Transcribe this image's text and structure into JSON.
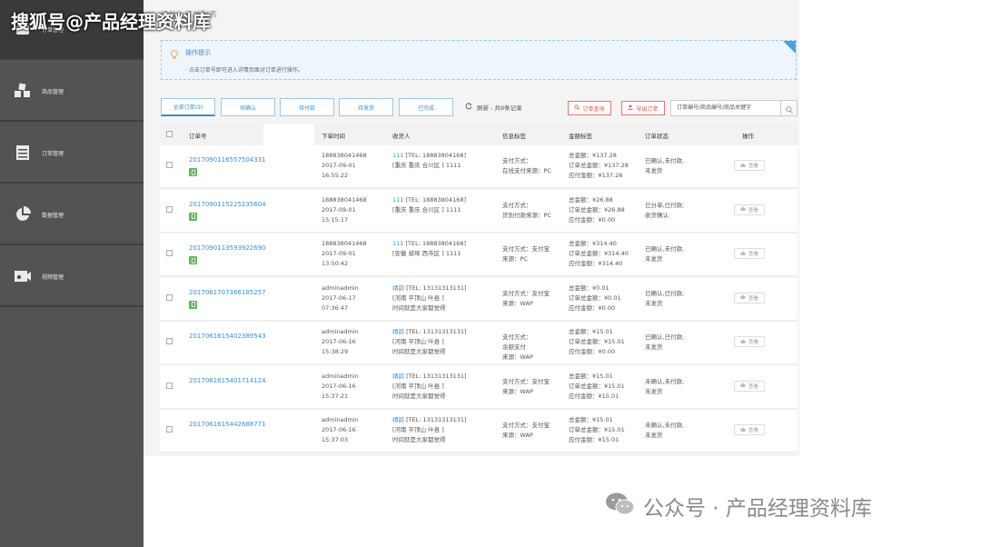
{
  "watermark": {
    "top": "搜狐号@产品经理资料库",
    "bottom": "公众号 · 产品经理资料库"
  },
  "breadcrumb": "订单 - 订单列表",
  "sidebar": {
    "items": [
      {
        "label": "订单管理",
        "icon": "home-icon"
      },
      {
        "label": "商品管理",
        "icon": "cubes-icon"
      },
      {
        "label": "订单管理",
        "icon": "list-icon"
      },
      {
        "label": "数据管理",
        "icon": "pie-chart-icon"
      },
      {
        "label": "视频管理",
        "icon": "video-icon"
      }
    ]
  },
  "tips": {
    "title": "操作提示",
    "line": "· 点击订单号即可进入详情页面对订单进行操作。"
  },
  "tabs": [
    "全部订单(9)",
    "待确认",
    "待付款",
    "待发货",
    "已完成"
  ],
  "refresh": "刷新 - 共9条记录",
  "buttons": {
    "search_orders": "订单查询",
    "export_orders": "导出订单"
  },
  "search": {
    "value": "订单编号/商品编号/商品关键字"
  },
  "columns": [
    "订单号",
    "下单时间",
    "收货人",
    "信息标签",
    "金额标签",
    "订单状态",
    "操作"
  ],
  "view_label": "查看",
  "rows": [
    {
      "order_no": "2017090116557504331",
      "badge": true,
      "time1": "188838041468",
      "time2": "2017-09-01",
      "time3": "16:55:22",
      "rec_name": "111",
      "rec1": " [TEL: 18883804168]",
      "rec2": "[重庆 重庆 合川区 ] 1111",
      "rec3": "",
      "info1": "支付方式：",
      "info2": "在线支付来源：PC",
      "info3": "",
      "amt1": "总金额：¥137.28",
      "amt2": "订单总金额：¥137.28",
      "amt3": "应付金额：¥137.28",
      "st1": "已确认,未付款,",
      "st2": "未发货"
    },
    {
      "order_no": "2017090115225235604",
      "badge": true,
      "time1": "188838041468",
      "time2": "2017-09-01",
      "time3": "15:15:17",
      "rec_name": "111",
      "rec1": " [TEL: 18883804168]",
      "rec2": "[重庆 重庆 合川区 ] 1111",
      "rec3": "",
      "info1": "支付方式：",
      "info2": "货到付款来源：PC",
      "info3": "",
      "amt1": "总金额：¥26.88",
      "amt2": "订单总金额：¥26.88",
      "amt3": "应付金额：¥0.00",
      "st1": "已分单,已付款,",
      "st2": "收货确认"
    },
    {
      "order_no": "2017090113593922690",
      "badge": true,
      "time1": "188838041468",
      "time2": "2017-09-01",
      "time3": "13:50:42",
      "rec_name": "111",
      "rec1": " [TEL: 18883804168]",
      "rec2": "[安徽 蚌埠 西市区 ] 1111",
      "rec3": "",
      "info1": "支付方式：支付宝",
      "info2": "来源：PC",
      "info3": "",
      "amt1": "总金额：¥314.40",
      "amt2": "订单总金额：¥314.40",
      "amt3": "应付金额：¥314.40",
      "st1": "已确认,未付款,",
      "st2": "未发货"
    },
    {
      "order_no": "2017061707366185257",
      "badge": true,
      "time1": "adminadmin",
      "time2": "2017-06-17",
      "time3": "07:36:47",
      "rec_name": "靖韵",
      "rec1": " [TEL: 13131313131]",
      "rec2": "[河南 平顶山 叶县 ]",
      "rec3": "时间就是大家都觉得",
      "info1": "支付方式：支付宝",
      "info2": "来源：WAP",
      "info3": "",
      "amt1": "总金额：¥0.01",
      "amt2": "订单总金额：¥0.01",
      "amt3": "应付金额：¥0.00",
      "st1": "已确认,已付款,",
      "st2": "未发货"
    },
    {
      "order_no": "2017061615402389543",
      "badge": false,
      "time1": "adminadmin",
      "time2": "2017-06-16",
      "time3": "15:38:29",
      "rec_name": "靖韵",
      "rec1": " [TEL: 13131313131]",
      "rec2": "[河南 平顶山 叶县 ]",
      "rec3": "时间就是大家都觉得",
      "info1": "支付方式：",
      "info2": "余额支付",
      "info3": "来源：WAP",
      "amt1": "总金额：¥15.01",
      "amt2": "订单总金额：¥15.01",
      "amt3": "应付金额：¥0.00",
      "st1": "已确认,已付款,",
      "st2": "未发货"
    },
    {
      "order_no": "2017061615401714124",
      "badge": false,
      "time1": "adminadmin",
      "time2": "2017-06-16",
      "time3": "15:37:21",
      "rec_name": "靖韵",
      "rec1": " [TEL: 13131313131]",
      "rec2": "[河南 平顶山 叶县 ]",
      "rec3": "时间就是大家都觉得",
      "info1": "支付方式：支付宝",
      "info2": "来源：WAP",
      "info3": "",
      "amt1": "总金额：¥15.01",
      "amt2": "订单总金额：¥15.01",
      "amt3": "应付金额：¥15.01",
      "st1": "未确认,未付款,",
      "st2": "未发货"
    },
    {
      "order_no": "2017061615442688771",
      "badge": false,
      "time1": "adminadmin",
      "time2": "2017-06-16",
      "time3": "15:37:03",
      "rec_name": "靖韵",
      "rec1": " [TEL: 13131313131]",
      "rec2": "[河南 平顶山 叶县 ]",
      "rec3": "时间就是大家都觉得",
      "info1": "支付方式：支付宝",
      "info2": "来源：WAP",
      "info3": "",
      "amt1": "总金额：¥15.01",
      "amt2": "订单总金额：¥15.01",
      "amt3": "应付金额：¥15.01",
      "st1": "未确认,未付款,",
      "st2": "未发货"
    }
  ]
}
